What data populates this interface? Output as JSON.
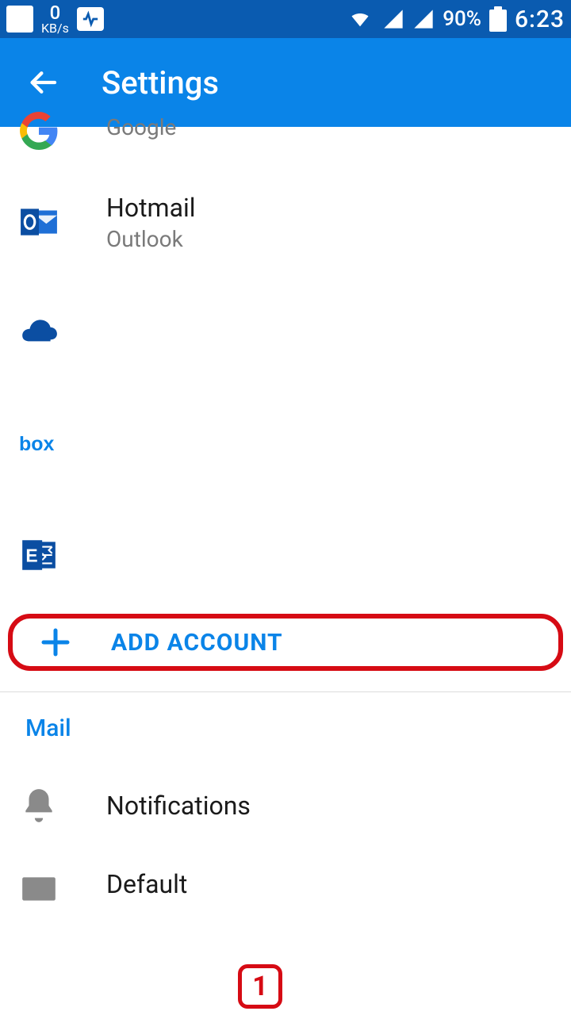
{
  "status": {
    "kb_value": "0",
    "kb_unit": "KB/s",
    "battery_pct": "90%",
    "clock": "6:23"
  },
  "header": {
    "title": "Settings"
  },
  "accounts": [
    {
      "name": "",
      "sub": "Google",
      "icon": "google"
    },
    {
      "name": "Hotmail",
      "sub": "Outlook",
      "icon": "outlook"
    },
    {
      "name": "",
      "sub": "",
      "icon": "onedrive"
    },
    {
      "name": "",
      "sub": "",
      "icon": "box"
    },
    {
      "name": "",
      "sub": "",
      "icon": "exchange"
    }
  ],
  "add_account_label": "ADD ACCOUNT",
  "section_mail": "Mail",
  "mail_items": [
    {
      "label": "Notifications"
    },
    {
      "label": "Default"
    }
  ],
  "annotation_number": "1"
}
